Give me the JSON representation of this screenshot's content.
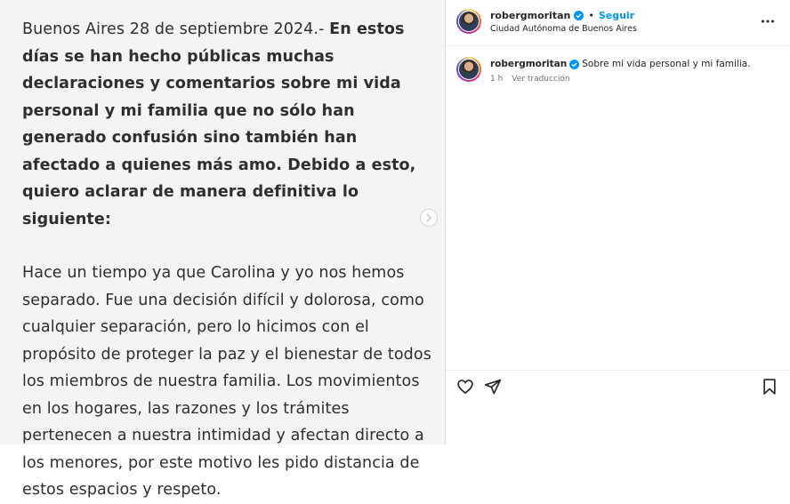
{
  "post": {
    "para1_plain": "Buenos Aires 28 de septiembre 2024.- ",
    "para1_bold": "En estos días se han hecho públicas muchas declaraciones y comentarios sobre mi vida personal y mi familia que no sólo han generado confusión sino también han afectado a quienes más amo. Debido a esto, quiero aclarar de manera definitiva lo siguiente:",
    "para2": "Hace un tiempo ya que Carolina y yo nos hemos separado. Fue una decisión difícil y dolorosa, como cualquier separación, pero lo hicimos con el propósito de proteger la paz y el bienestar de todos los miembros de nuestra familia. Los movimientos en los hogares, las razones y los trámites pertenecen a nuestra intimidad y afectan directo a los menores, por este motivo les pido distancia de estos espacios y respeto."
  },
  "header": {
    "username": "robergmoritan",
    "separator": "•",
    "follow_label": "Seguir",
    "location": "Ciudad Autónoma de Buenos Aires"
  },
  "caption": {
    "username": "robergmoritan",
    "text": "Sobre mi vida personal y mi familia.",
    "time": "1 h",
    "translate_label": "Ver traducción"
  },
  "icons": {
    "verified": "verified-badge-icon",
    "more": "more-options-icon",
    "next": "chevron-right-icon",
    "like": "heart-icon",
    "share": "paper-plane-icon",
    "save": "bookmark-icon"
  },
  "colors": {
    "accent": "#0095f6",
    "text": "#262626",
    "muted": "#737373",
    "image_bg": "#f4f4f4"
  }
}
